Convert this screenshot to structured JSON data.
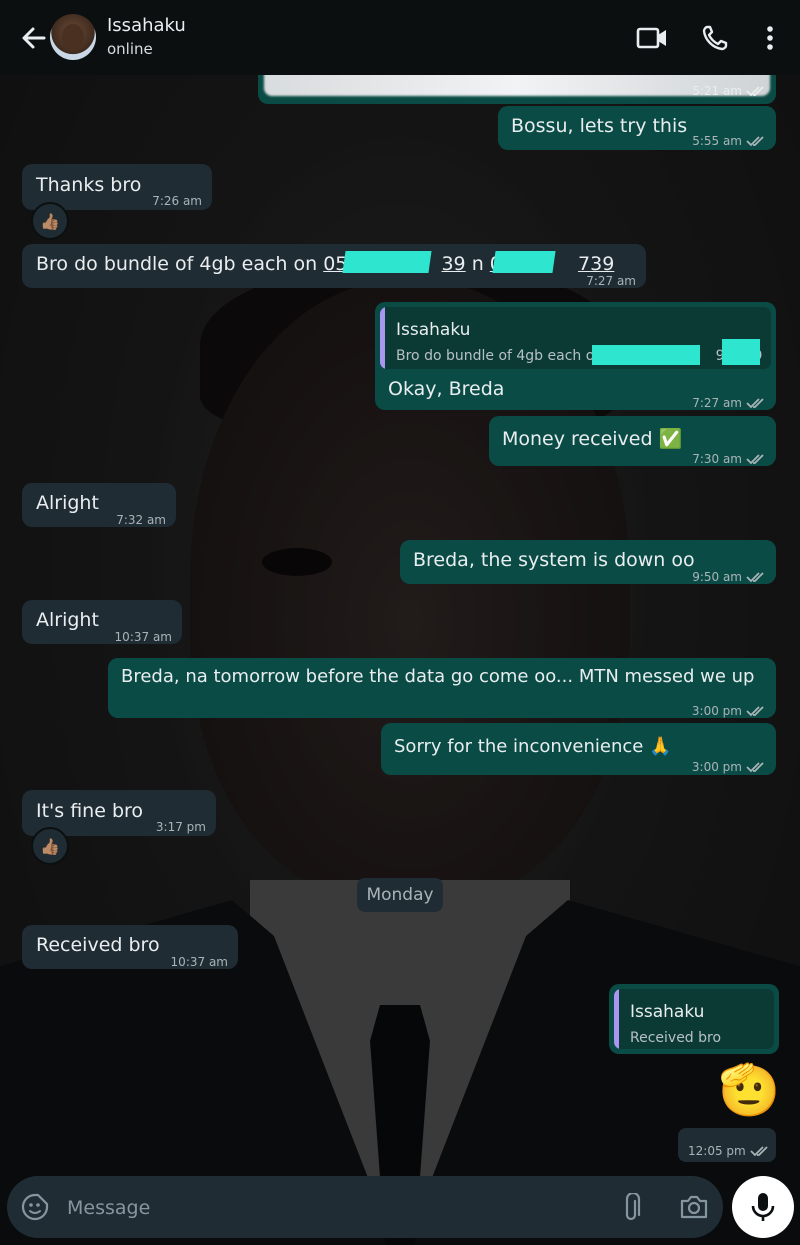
{
  "header": {
    "contact_name": "Issahaku",
    "contact_status": "online",
    "icons": [
      "back-arrow-icon",
      "video-call-icon",
      "voice-call-icon",
      "more-options-icon"
    ]
  },
  "messages": [
    {
      "dir": "out",
      "time": "5:21 am",
      "content": "blurred image"
    },
    {
      "dir": "out",
      "text": "Bossu, lets try this",
      "time": "5:55 am"
    },
    {
      "dir": "in",
      "text": "Thanks bro",
      "time": "7:26 am",
      "reaction": "👍🏽"
    },
    {
      "dir": "in",
      "text_parts": [
        "Bro do bundle of 4gb each on ",
        "054",
        "39",
        " n ",
        "059",
        "739"
      ],
      "time": "7:27 am"
    },
    {
      "dir": "out",
      "reply_to": {
        "name": "Issahaku",
        "text_start": "Bro do bundle of 4gb each on ",
        "text_mid": "93",
        "text_end": "9"
      },
      "text": "Okay, Breda",
      "time": "7:27 am"
    },
    {
      "dir": "out",
      "text": "Money received ✅",
      "time": "7:30 am"
    },
    {
      "dir": "in",
      "text": "Alright",
      "time": "7:32 am"
    },
    {
      "dir": "out",
      "text": "Breda, the system is down oo",
      "time": "9:50 am"
    },
    {
      "dir": "in",
      "text": "Alright",
      "time": "10:37 am"
    },
    {
      "dir": "out",
      "text": "Breda, na tomorrow before the data go come oo... MTN messed we up",
      "time": "3:00 pm"
    },
    {
      "dir": "out",
      "text": "Sorry for the inconvenience 🙏",
      "time": "3:00 pm"
    },
    {
      "dir": "in",
      "text": "It's fine bro",
      "time": "3:17 pm",
      "reaction": "👍🏽"
    },
    {
      "dir": "in",
      "text": "Received bro",
      "time": "10:37 am"
    },
    {
      "dir": "out",
      "reply_to": {
        "name": "Issahaku",
        "text": "Received bro"
      },
      "emoji": "🫡",
      "time": "12:05 pm"
    }
  ],
  "day_separator": "Monday",
  "input": {
    "placeholder": "Message"
  },
  "colors": {
    "header_bg": "#0b0f10",
    "incoming_bubble": "#1f2c33",
    "outgoing_bubble": "#0a4c45",
    "read_ticks": "#aab4b8",
    "quote_bar": "#a896f0",
    "redaction": "#2ee6cf"
  },
  "input_icons": [
    "sticker-icon",
    "attach-icon",
    "camera-icon",
    "mic-icon"
  ]
}
